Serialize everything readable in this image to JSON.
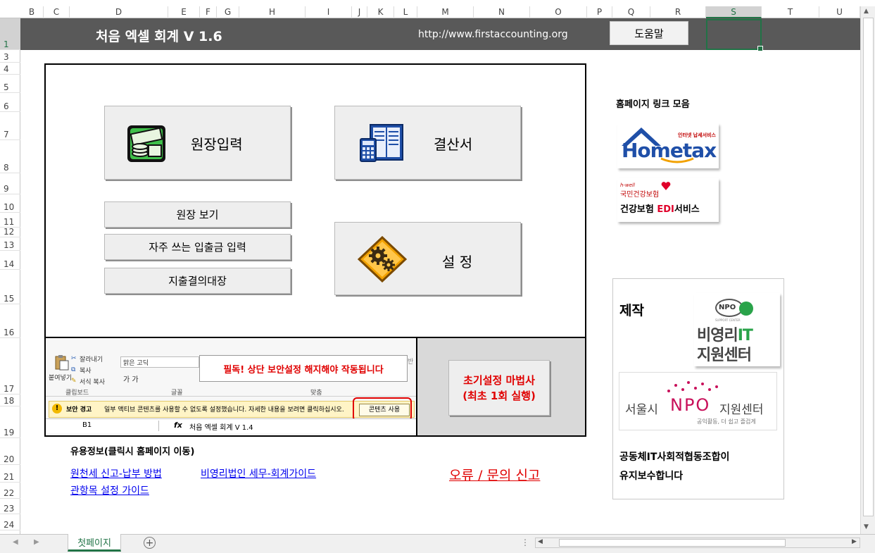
{
  "columns": [
    "B",
    "C",
    "D",
    "E",
    "F",
    "G",
    "H",
    "I",
    "J",
    "K",
    "L",
    "M",
    "N",
    "O",
    "P",
    "Q",
    "R",
    "S",
    "T",
    "U"
  ],
  "selected_column": "S",
  "rows": [
    "1",
    "3",
    "4",
    "5",
    "6",
    "7",
    "8",
    "9",
    "10",
    "11",
    "12",
    "13",
    "14",
    "15",
    "16",
    "17",
    "18",
    "19",
    "20",
    "21",
    "22",
    "23",
    "24"
  ],
  "selected_row": "1",
  "banner": {
    "title": "처음 엑셀 회계 V 1.6",
    "url": "http://www.firstaccounting.org",
    "help_label": "도움말"
  },
  "main": {
    "ledger_entry": "원장입력",
    "statements": "결산서",
    "settings": "설 정",
    "ledger_view": "원장 보기",
    "frequent_entry": "자주 쓰는 입출금 입력",
    "expense_register": "지출결의대장"
  },
  "screenshot": {
    "paste": "붙여넣기",
    "cut": "잘라내기",
    "copy": "복사",
    "format_painter": "서식 복사",
    "clipboard_group": "클립보드",
    "font_name": "맑은 고딕",
    "font_group": "글꼴",
    "align_group": "맞춤",
    "bold_italic": "가  가",
    "must_read": "필독! 상단 보안설정 해지해야 작동됩니다",
    "security_title": "보안 경고",
    "security_text": "일부 액티브 콘텐츠를 사용할 수 없도록 설정했습니다. 자세한 내용을 보려면 클릭하십시오.",
    "enable_content": "콘텐츠 사용",
    "name_box": "B1",
    "fx": "fx",
    "formula_value": "처음 엑셀 회계 V 1.4",
    "side_label": "반"
  },
  "wizard": {
    "line1": "초기설정 마법사",
    "line2": "(최초 1회 실행)"
  },
  "useful": {
    "header": "유용정보(클릭시 홈페이지 이동)",
    "link_withholding": "원천세 신고-납부 방법",
    "link_nonprofit": "비영리법인 세무-회계가이드",
    "link_account": "관항목 설정 가이드",
    "report": "오류 / 문의 신고"
  },
  "side": {
    "links_header": "홈페이지 링크 모음",
    "hometax_small": "인터넷 납세서비스",
    "hometax_logo": "Hometax",
    "nhis_small": "h-well",
    "nhis_line1": "국민건강보험",
    "nhis_line2a": "건강보험 ",
    "nhis_line2b": "EDI",
    "nhis_line2c": "서비스",
    "maker_label": "제작",
    "npo_badge": "NPO",
    "npo_sub": "SUPPORT CENTER",
    "npoit_line1": "비영리",
    "npoit_it": "IT",
    "npoit_line2": "지원센터",
    "seoul_a": "서울시",
    "seoul_npo": "NPO",
    "seoul_b": "지원센터",
    "seoul_slogan": "공익활동, 더 쉽고 즐겁게",
    "coop_line1": "공동체IT사회적협동조합이",
    "coop_line2": "유지보수합니다"
  },
  "sheet_tab": "첫페이지",
  "colors": {
    "excel_green": "#217346",
    "banner_gray": "#595959",
    "alert_red": "#e00000",
    "link_blue": "#0000ee"
  }
}
